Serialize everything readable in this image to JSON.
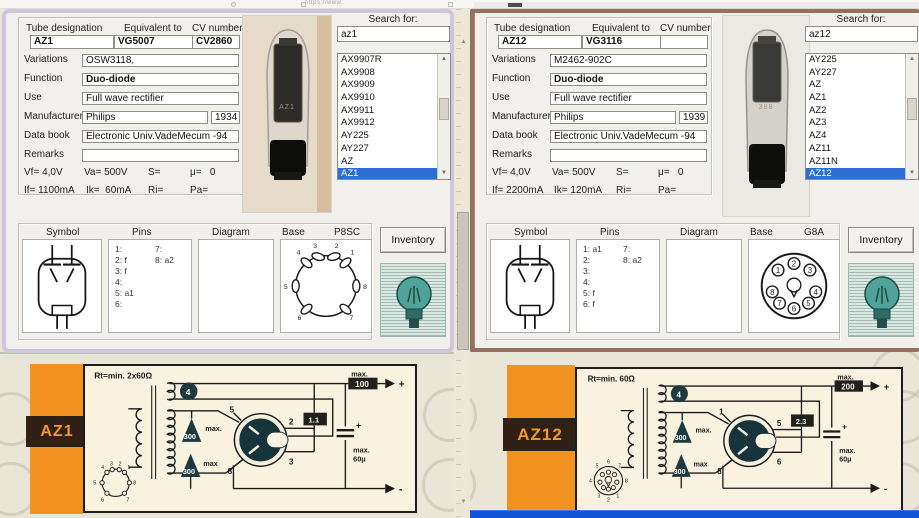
{
  "chrome": {
    "url_fragment": "https://www."
  },
  "pin_numbers": [
    "1",
    "2",
    "3",
    "4",
    "5",
    "6",
    "7",
    "8"
  ],
  "windows": [
    {
      "photo_text": "AZ1",
      "form": {
        "col1_label": "Tube designation",
        "col1_value": "AZ1",
        "col2_label": "Equivalent to",
        "col2_value": "VG5007",
        "col3_label": "CV number",
        "col3_value": "CV2860",
        "variations_label": "Variations",
        "variations": "OSW3118,",
        "function_label": "Function",
        "function": "Duo-diode",
        "use_label": "Use",
        "use": "Full wave rectifier",
        "manufacturer_label": "Manufacturer",
        "manufacturer": "Philips",
        "year": "1934",
        "databook_label": "Data book",
        "databook": "Electronic Univ.VadeMecum -94",
        "remarks_label": "Remarks",
        "remarks": "",
        "spec_vf": "Vf= 4,0V",
        "spec_va": "Va= 500V",
        "spec_s": "S=",
        "spec_mu": "μ=   0",
        "spec_if": "If= 1100mA",
        "spec_ik": "Ik=  60mA",
        "spec_ri": "Ri=",
        "spec_pa": "Pa="
      },
      "search": {
        "label": "Search for:",
        "value": "az1",
        "items": [
          "AX9907R",
          "AX9908",
          "AX9909",
          "AX9910",
          "AX9911",
          "AX9912",
          "AY225",
          "AY227",
          "AZ",
          "AZ1"
        ],
        "selected": "AZ1"
      },
      "panel": {
        "symbol_label": "Symbol",
        "pins_label": "Pins",
        "pins_col1": [
          "1:",
          "2: f",
          "3: f",
          "4:",
          "5: a1",
          "6:"
        ],
        "pins_col2": [
          "7:",
          "8: a2"
        ],
        "diagram_label": "Diagram",
        "base_label": "Base",
        "base_type": "P8SC",
        "inventory_label": "Inventory"
      },
      "datasheet": {
        "badge": "AZ1",
        "rt": "Rt=min. 2x60Ω",
        "max_label": "max.",
        "max_value": "100",
        "series_value": "1.1",
        "heater": "4",
        "tri1_label": "max.",
        "tri1_value": "300",
        "tri2_label": "max",
        "tri2_value": "300",
        "cap_plus": "+",
        "cap_line1": "max.",
        "cap_line2": "60μ",
        "out_plus": "+",
        "out_minus": "-",
        "tube_pin_tl": "5",
        "tube_pin_tr": "2",
        "tube_pin_br": "3",
        "tube_pin_bl": "8"
      }
    },
    {
      "photo_text": "388",
      "form": {
        "col1_label": "Tube designation",
        "col1_value": "AZ12",
        "col2_label": "Equivalent to",
        "col2_value": "VG3116",
        "col3_label": "CV number",
        "col3_value": "",
        "variations_label": "Variations",
        "variations": "M2462-902C",
        "function_label": "Function",
        "function": "Duo-diode",
        "use_label": "Use",
        "use": "Full wave rectifier",
        "manufacturer_label": "Manufacturer",
        "manufacturer": "Philips",
        "year": "1939",
        "databook_label": "Data book",
        "databook": "Electronic Univ.VadeMecum -94",
        "remarks_label": "Remarks",
        "remarks": "",
        "spec_vf": "Vf= 4,0V",
        "spec_va": "Va= 500V",
        "spec_s": "S=",
        "spec_mu": "μ=   0",
        "spec_if": "If= 2200mA",
        "spec_ik": "Ik= 120mA",
        "spec_ri": "Ri=",
        "spec_pa": "Pa="
      },
      "search": {
        "label": "Search for:",
        "value": "az12",
        "items": [
          "AY225",
          "AY227",
          "AZ",
          "AZ1",
          "AZ2",
          "AZ3",
          "AZ4",
          "AZ11",
          "AZ11N",
          "AZ12"
        ],
        "selected": "AZ12"
      },
      "panel": {
        "symbol_label": "Symbol",
        "pins_label": "Pins",
        "pins_col1": [
          "1: a1",
          "2:",
          "3:",
          "4:",
          "5: f",
          "6: f"
        ],
        "pins_col2": [
          "7:",
          "8: a2"
        ],
        "diagram_label": "Diagram",
        "base_label": "Base",
        "base_type": "G8A",
        "inventory_label": "Inventory"
      },
      "datasheet": {
        "badge": "AZ12",
        "rt": "Rt=min. 60Ω",
        "max_label": "max.",
        "max_value": "200",
        "series_value": "2.3",
        "heater": "4",
        "tri1_label": "max.",
        "tri1_value": "300",
        "tri2_label": "max",
        "tri2_value": "300",
        "cap_plus": "+",
        "cap_line1": "max.",
        "cap_line2": "60μ",
        "out_plus": "+",
        "out_minus": "-",
        "tube_pin_tl": "1",
        "tube_pin_tr": "5",
        "tube_pin_br": "6",
        "tube_pin_bl": "8"
      }
    }
  ]
}
